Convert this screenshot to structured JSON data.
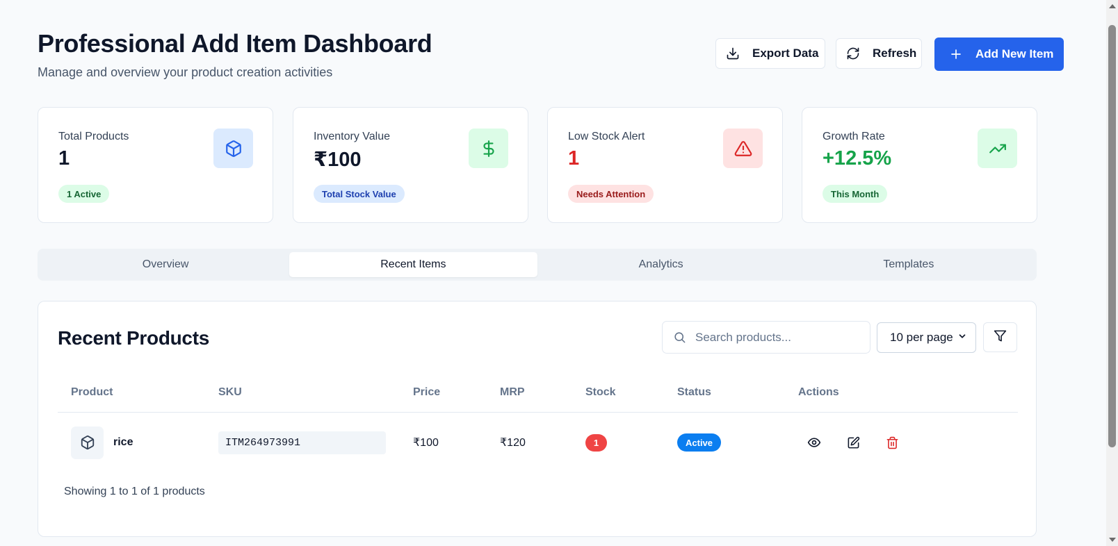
{
  "header": {
    "title": "Professional Add Item Dashboard",
    "subtitle": "Manage and overview your product creation activities",
    "export_label": "Export Data",
    "refresh_label": "Refresh",
    "add_label": "Add New Item"
  },
  "stats": [
    {
      "label": "Total Products",
      "value": "1",
      "badge": "1 Active",
      "icon": "box-icon",
      "value_color": "#0f172a",
      "icon_bg": "#dbeafe",
      "icon_color": "#2563eb",
      "badge_bg": "#dcfce7",
      "badge_color": "#166534"
    },
    {
      "label": "Inventory Value",
      "value": "₹100",
      "badge": "Total Stock Value",
      "icon": "dollar-icon",
      "value_color": "#0f172a",
      "icon_bg": "#dcfce7",
      "icon_color": "#16a34a",
      "badge_bg": "#dbeafe",
      "badge_color": "#1e40af"
    },
    {
      "label": "Low Stock Alert",
      "value": "1",
      "badge": "Needs Attention",
      "icon": "alert-triangle-icon",
      "value_color": "#dc2626",
      "icon_bg": "#fee2e2",
      "icon_color": "#dc2626",
      "badge_bg": "#fee2e2",
      "badge_color": "#991b1b"
    },
    {
      "label": "Growth Rate",
      "value": "+12.5%",
      "badge": "This Month",
      "icon": "trending-up-icon",
      "value_color": "#16a34a",
      "icon_bg": "#dcfce7",
      "icon_color": "#16a34a",
      "badge_bg": "#dcfce7",
      "badge_color": "#166534"
    }
  ],
  "tabs": [
    {
      "label": "Overview",
      "active": false
    },
    {
      "label": "Recent Items",
      "active": true
    },
    {
      "label": "Analytics",
      "active": false
    },
    {
      "label": "Templates",
      "active": false
    }
  ],
  "panel": {
    "title": "Recent Products",
    "search_placeholder": "Search products...",
    "per_page": "10 per page",
    "columns": [
      "Product",
      "SKU",
      "Price",
      "MRP",
      "Stock",
      "Status",
      "Actions"
    ],
    "rows": [
      {
        "product": "rice",
        "sku": "ITM264973991",
        "price": "₹100",
        "mrp": "₹120",
        "stock": "1",
        "status": "Active"
      }
    ],
    "footer": "Showing 1 to 1 of 1 products"
  },
  "colors": {
    "primary": "#2563eb",
    "danger": "#ef4444",
    "status_active": "#0b7ef0"
  }
}
